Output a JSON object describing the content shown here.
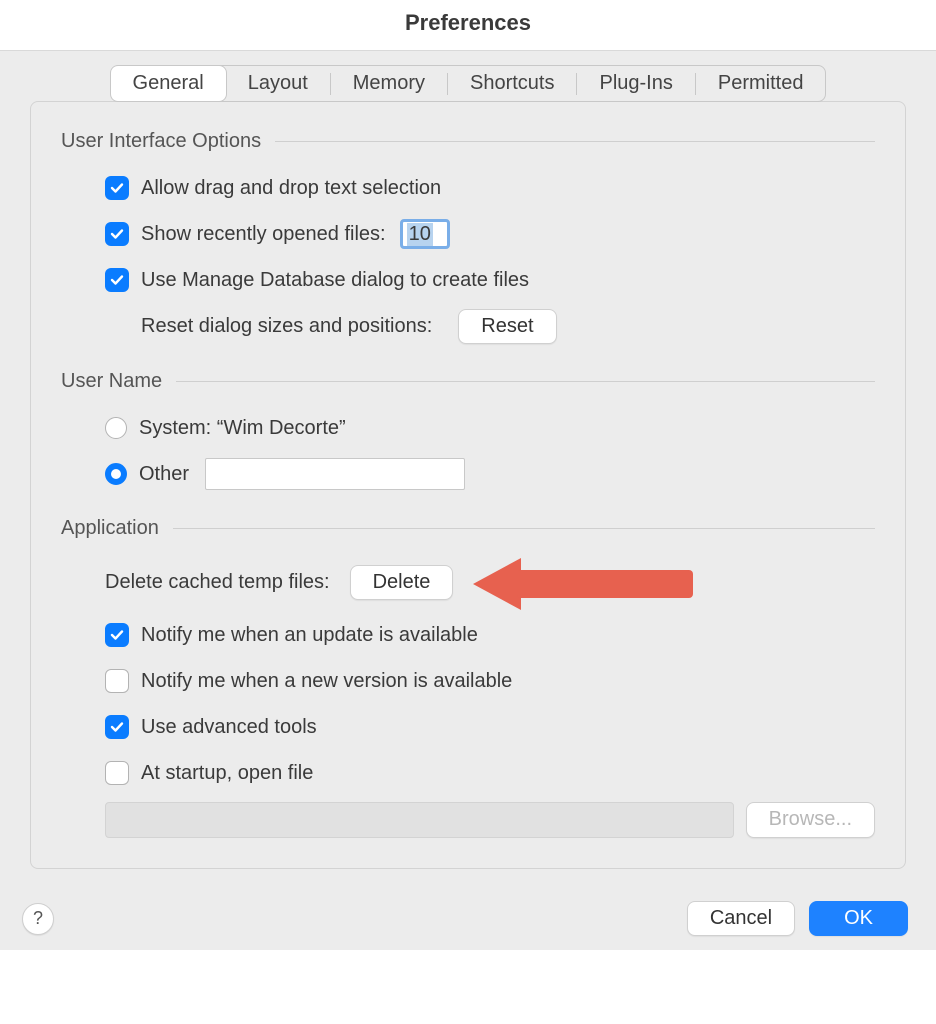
{
  "title": "Preferences",
  "tabs": {
    "general": "General",
    "layout": "Layout",
    "memory": "Memory",
    "shortcuts": "Shortcuts",
    "plugins": "Plug-Ins",
    "permitted": "Permitted"
  },
  "sections": {
    "ui_options": "User Interface Options",
    "user_name": "User Name",
    "application": "Application"
  },
  "ui": {
    "allow_drag": "Allow drag and drop text selection",
    "show_recent": "Show recently opened files:",
    "recent_count": "10",
    "use_manage_db": "Use Manage Database dialog to create files",
    "reset_label": "Reset dialog sizes and positions:",
    "reset_btn": "Reset"
  },
  "user": {
    "system_label": "System: “Wim Decorte”",
    "other_label": "Other",
    "other_value": ""
  },
  "app": {
    "delete_label": "Delete cached temp files:",
    "delete_btn": "Delete",
    "notify_update": "Notify me when an update is available",
    "notify_version": "Notify me when a new version is available",
    "advanced": "Use advanced tools",
    "startup_open": "At startup, open file",
    "browse_btn": "Browse..."
  },
  "footer": {
    "help": "?",
    "cancel": "Cancel",
    "ok": "OK"
  }
}
